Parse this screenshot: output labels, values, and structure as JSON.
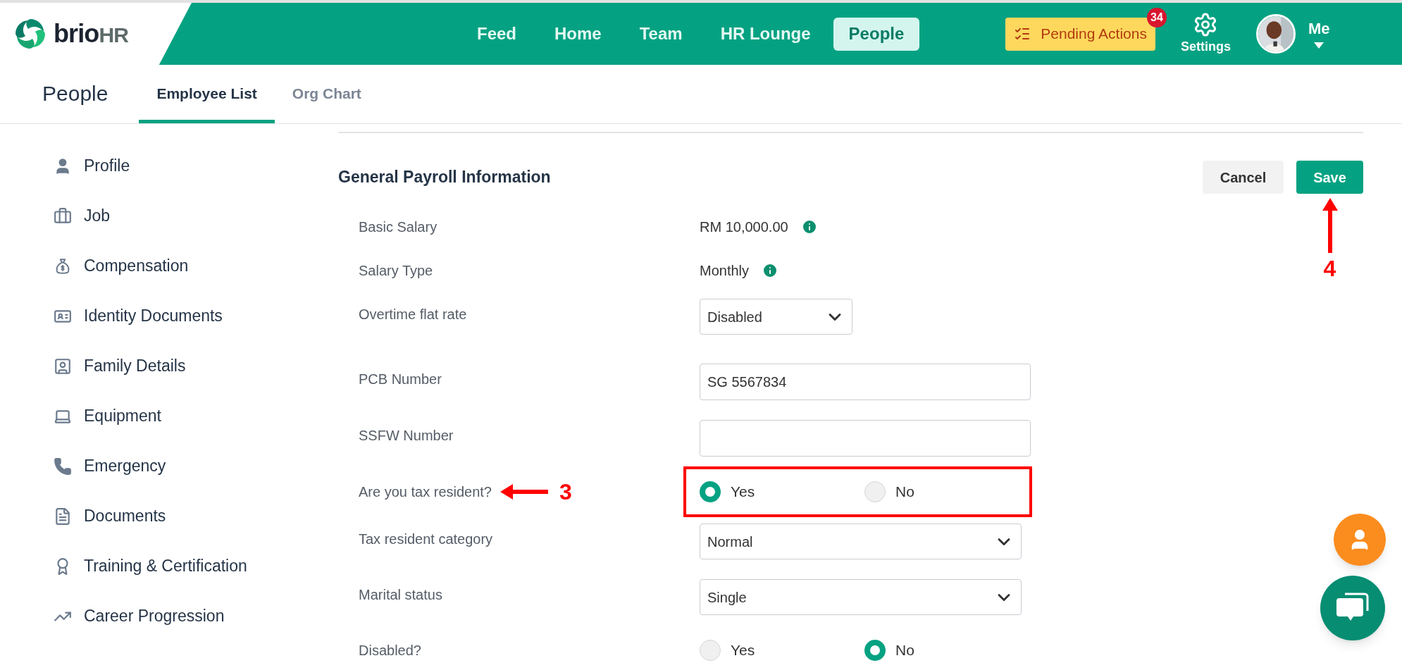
{
  "brand": {
    "word": "brio",
    "suffix": "HR"
  },
  "nav": [
    {
      "label": "Feed",
      "selected": false
    },
    {
      "label": "Home",
      "selected": false
    },
    {
      "label": "Team",
      "selected": false
    },
    {
      "label": "HR Lounge",
      "selected": false
    },
    {
      "label": "People",
      "selected": true
    }
  ],
  "pending_actions": {
    "label": "Pending Actions",
    "badge": "34"
  },
  "settings": {
    "label": "Settings"
  },
  "user": {
    "label": "Me"
  },
  "page_title": "People",
  "tabs": [
    {
      "label": "Employee List",
      "selected": true
    },
    {
      "label": "Org Chart",
      "selected": false
    }
  ],
  "sidebar": {
    "items": [
      {
        "label": "Profile"
      },
      {
        "label": "Job"
      },
      {
        "label": "Compensation"
      },
      {
        "label": "Identity Documents"
      },
      {
        "label": "Family Details"
      },
      {
        "label": "Equipment"
      },
      {
        "label": "Emergency"
      },
      {
        "label": "Documents"
      },
      {
        "label": "Training & Certification"
      },
      {
        "label": "Career Progression"
      }
    ]
  },
  "section": {
    "title": "General Payroll Information",
    "buttons": [
      {
        "label": "Cancel",
        "kind": "secondary"
      },
      {
        "label": "Save",
        "kind": "primary",
        "annotation": "4"
      }
    ]
  },
  "fields": [
    {
      "kind": "text",
      "label": "Basic Salary",
      "value": "RM 10,000.00"
    },
    {
      "kind": "text",
      "label": "Salary Type",
      "value": "Monthly"
    },
    {
      "kind": "select-short",
      "label": "Overtime flat rate",
      "value": "Disabled"
    },
    {
      "kind": "input",
      "label": "PCB Number",
      "value": "SG 5567834"
    },
    {
      "kind": "input",
      "label": "SSFW Number"
    },
    {
      "kind": "radio",
      "label": "Are you tax resident?",
      "annotation": "3",
      "highlighted": true,
      "options": [
        {
          "label": "Yes",
          "selected": true
        },
        {
          "label": "No",
          "selected": false
        }
      ]
    },
    {
      "kind": "select",
      "label": "Tax resident category",
      "value": "Normal"
    },
    {
      "kind": "select",
      "label": "Marital status",
      "value": "Single"
    },
    {
      "kind": "radio",
      "label": "Disabled?",
      "highlighted": false,
      "options": [
        {
          "label": "Yes",
          "selected": false
        },
        {
          "label": "No",
          "selected": true
        }
      ]
    }
  ]
}
